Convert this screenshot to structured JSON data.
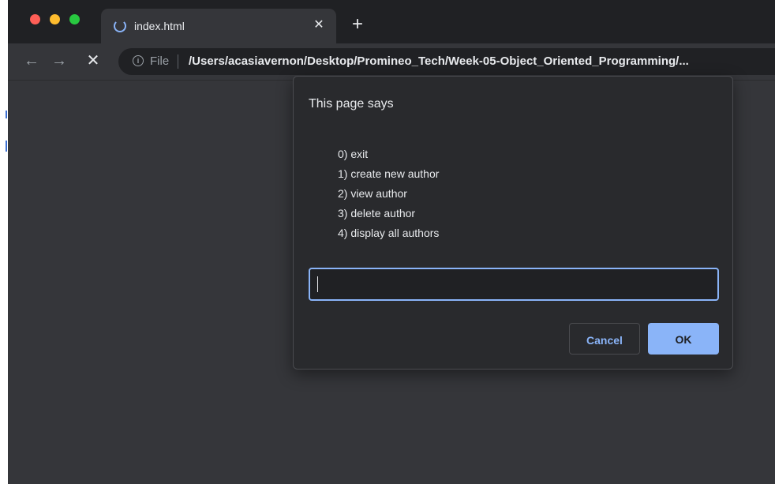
{
  "browser": {
    "tab": {
      "title": "index.html",
      "close_icon": "close-icon",
      "loading_icon": "spinner-icon"
    },
    "new_tab_icon": "plus-icon",
    "toolbar": {
      "back_icon": "arrow-left-icon",
      "forward_icon": "arrow-right-icon",
      "stop_icon": "close-icon"
    },
    "omnibox": {
      "info_icon": "info-icon",
      "scheme_label": "File",
      "url": "/Users/acasiavernon/Desktop/Promineo_Tech/Week-05-Object_Oriented_Programming/..."
    }
  },
  "dialog": {
    "title": "This page says",
    "lines": [
      "0) exit",
      "1) create new author",
      "2) view author",
      "3) delete author",
      "4) display all authors"
    ],
    "input": {
      "value": "",
      "placeholder": ""
    },
    "cancel_label": "Cancel",
    "ok_label": "OK"
  },
  "colors": {
    "accent": "#8ab4f8",
    "window_bg": "#35363a",
    "tabstrip_bg": "#202124",
    "dialog_bg": "#292a2d"
  }
}
